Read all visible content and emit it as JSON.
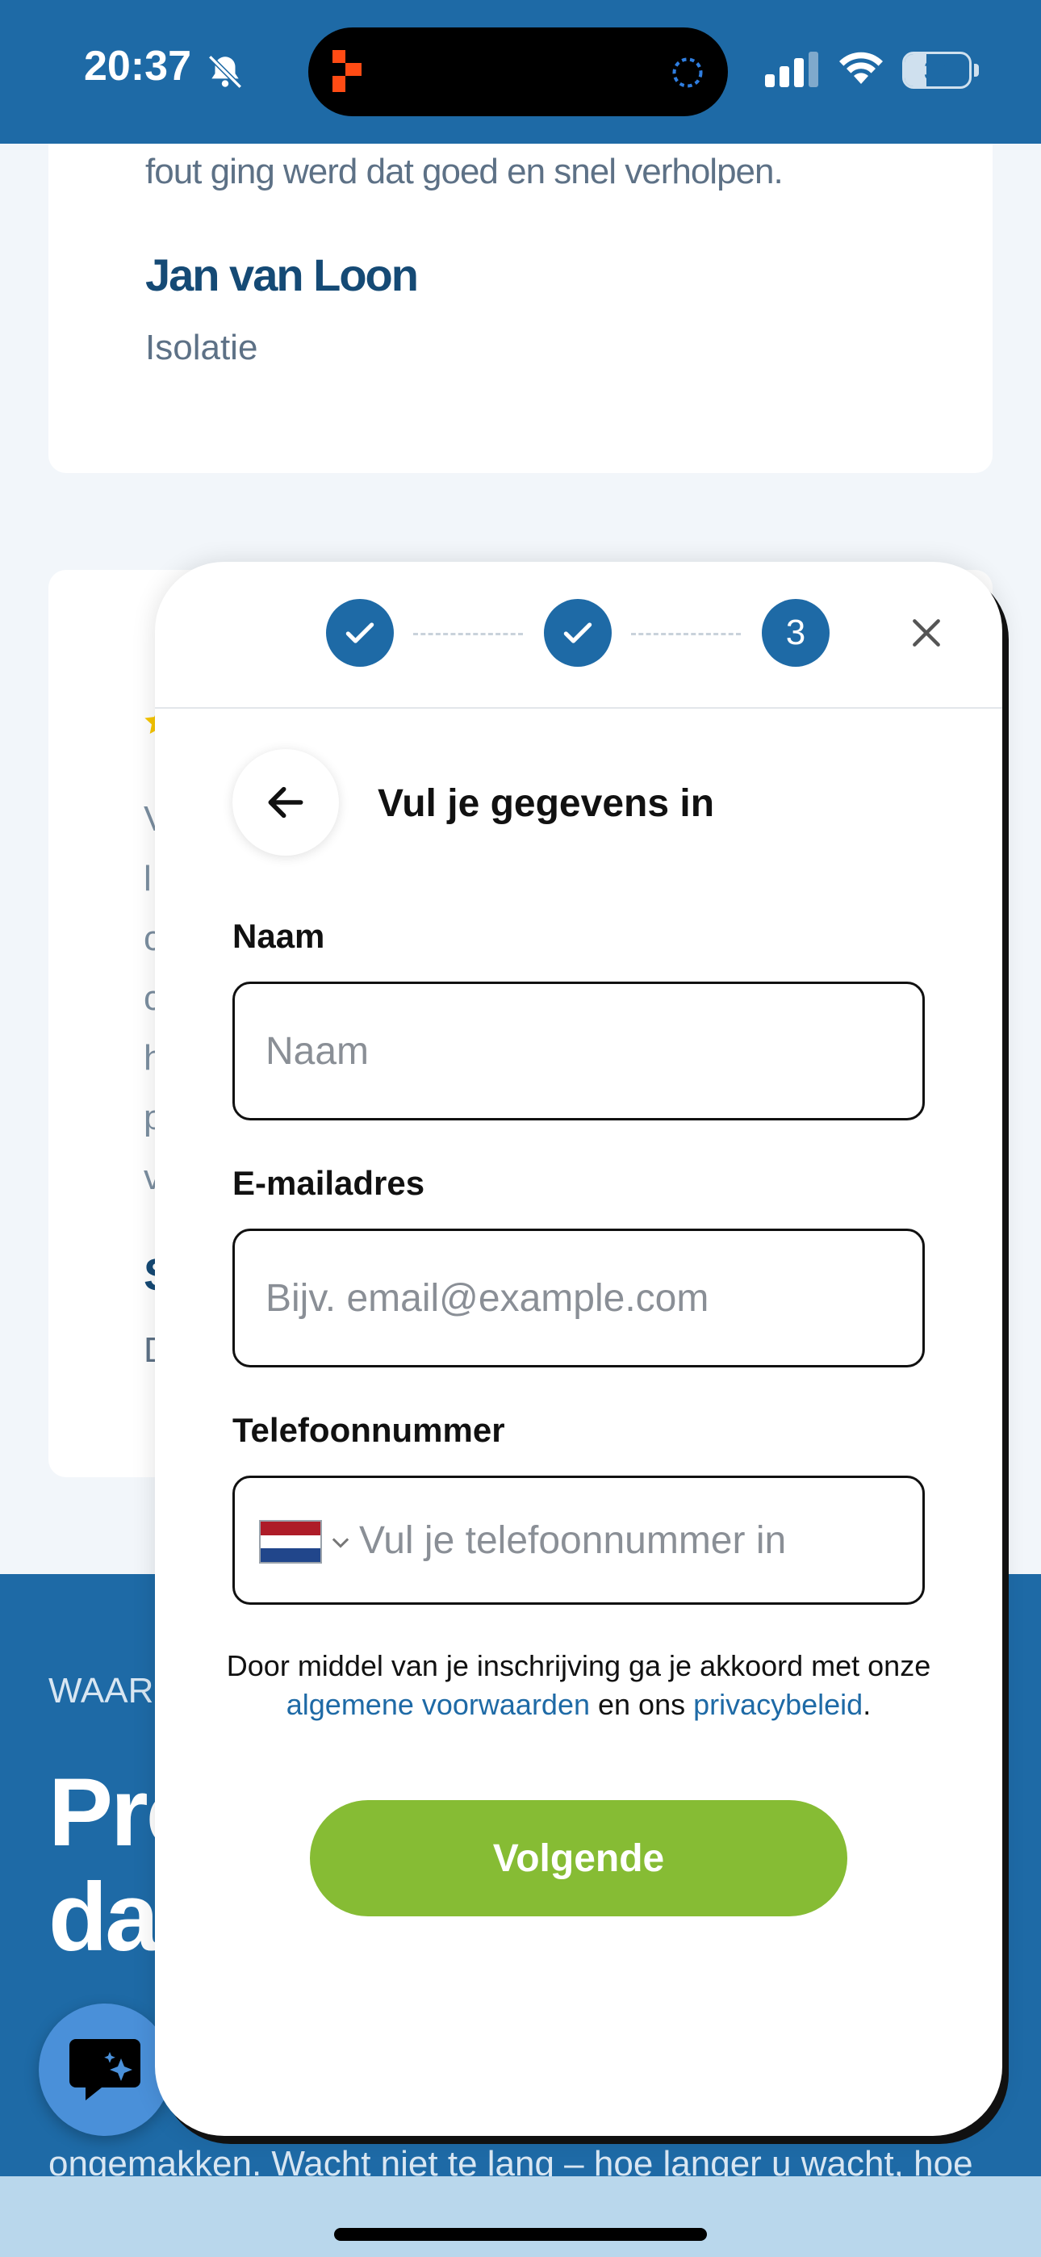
{
  "status_bar": {
    "time": "20:37",
    "battery_level": "34",
    "battery_fraction": 0.34
  },
  "background": {
    "review_text_tail": "fout ging werd dat goed en snel verholpen.",
    "review_author": "Jan van Loon",
    "review_category": "Isolatie",
    "second_card_line_initials": [
      "V",
      "l",
      "c",
      "c",
      "h",
      "p",
      "v"
    ],
    "second_card_name_initial": "S",
    "second_card_category_initial": "D",
    "section_eyebrow": "WAAR",
    "section_heading_lines": [
      "Pro",
      "da"
    ],
    "section_bottom_text": "ongemakken. Wacht niet te lang – hoe langer u wacht, hoe"
  },
  "stepper": {
    "steps": [
      {
        "state": "completed",
        "icon": "check-icon"
      },
      {
        "state": "completed",
        "icon": "check-icon"
      },
      {
        "state": "active",
        "label": "3"
      }
    ]
  },
  "form": {
    "title": "Vul je gegevens in",
    "fields": {
      "name": {
        "label": "Naam",
        "placeholder": "Naam",
        "value": ""
      },
      "email": {
        "label": "E-mailadres",
        "placeholder": "Bijv. email@example.com",
        "value": ""
      },
      "phone": {
        "label": "Telefoonnummer",
        "placeholder": "Vul je telefoonnummer in",
        "value": "",
        "country": "NL"
      }
    },
    "terms": {
      "before": "Door middel van je inschrijving ga je akkoord met onze ",
      "terms_link": "algemene voorwaarden",
      "middle": " en ons ",
      "privacy_link": "privacybeleid",
      "after": "."
    },
    "next_label": "Volgende"
  },
  "colors": {
    "brand_blue": "#1e6aa6",
    "accent_green": "#86bc34",
    "link_blue": "#1e6aa6"
  }
}
